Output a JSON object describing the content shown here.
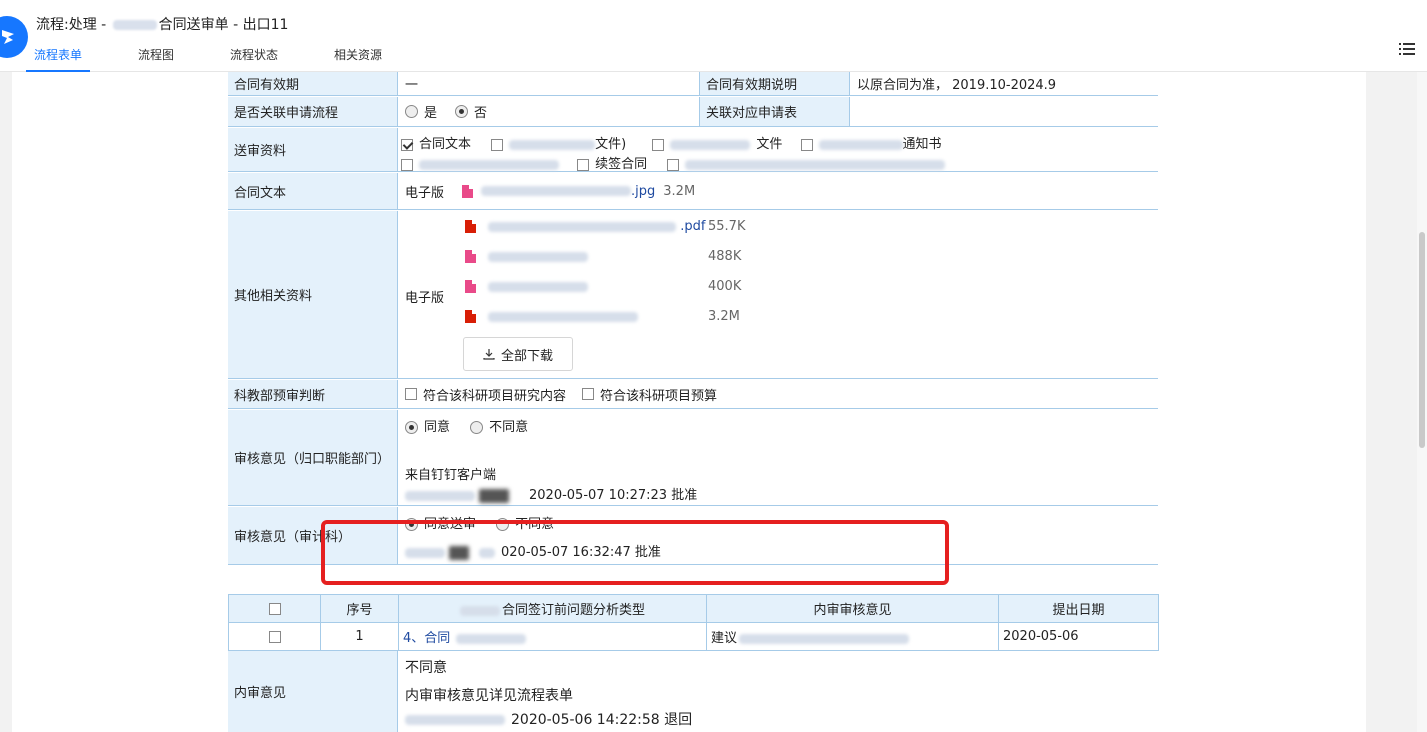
{
  "window": {
    "title_prefix": "流程:处理 - ",
    "title_suffix": "合同送审单 - 出口11"
  },
  "tabs": [
    {
      "label": "流程表单",
      "active": true
    },
    {
      "label": "流程图",
      "active": false
    },
    {
      "label": "流程状态",
      "active": false
    },
    {
      "label": "相关资源",
      "active": false
    }
  ],
  "form": {
    "validity": {
      "label": "合同有效期",
      "value": "一",
      "desc_label": "合同有效期说明",
      "desc_value": "以原合同为准， 2019.10-2024.9"
    },
    "linked": {
      "label": "是否关联申请流程",
      "opt_yes": "是",
      "opt_no": "否",
      "selected": "否",
      "link_label": "关联对应申请表"
    },
    "materials": {
      "label": "送审资料",
      "items": [
        {
          "label": "合同文本",
          "checked": true
        },
        {
          "label": "文件)",
          "checked": false
        },
        {
          "label": "文件",
          "checked": false
        },
        {
          "label": "通知书",
          "checked": false
        },
        {
          "label": "续签合同",
          "checked": false
        }
      ]
    },
    "contract_text": {
      "label": "合同文本",
      "type": "电子版",
      "file_ext": ".jpg",
      "file_size": "3.2M"
    },
    "other_materials": {
      "label": "其他相关资料",
      "type": "电子版",
      "files": [
        {
          "kind": "pdf",
          "ext": ".pdf",
          "size": "55.7K"
        },
        {
          "kind": "img",
          "ext": "",
          "size": "488K"
        },
        {
          "kind": "img",
          "ext": "",
          "size": "400K"
        },
        {
          "kind": "pdf",
          "ext": "",
          "size": "3.2M"
        }
      ],
      "download_label": "全部下载"
    },
    "pre_review": {
      "label": "科教部预审判断",
      "opt1": "符合该科研项目研究内容",
      "opt2": "符合该科研项目预算"
    },
    "review1": {
      "label": "审核意见（归口职能部门）",
      "opt_agree": "同意",
      "opt_disagree": "不同意",
      "selected": "同意",
      "source": "来自钉钉客户端",
      "sign": "2020-05-07 10:27:23 批准"
    },
    "review2": {
      "label": "审核意见（审计科）",
      "opt_agree": "同意送审",
      "opt_disagree": "不同意",
      "selected": "同意送审",
      "sign": "020-05-07 16:32:47 批准"
    },
    "issue_table": {
      "headers": [
        "序号",
        "合同签订前问题分析类型",
        "内审审核意见",
        "提出日期"
      ],
      "rows": [
        {
          "no": "1",
          "type": "4、合同",
          "opinion": "建议",
          "date": "2020-05-06"
        }
      ]
    },
    "internal_audit": {
      "label": "内审意见",
      "result": "不同意",
      "text": "内审审核意见详见流程表单",
      "sign": "2020-05-06 14:22:58 退回"
    }
  },
  "colors": {
    "accent": "#1677ff",
    "label_bg": "#e4f1fb",
    "border": "#a6cbe8",
    "highlight": "#e52020"
  }
}
